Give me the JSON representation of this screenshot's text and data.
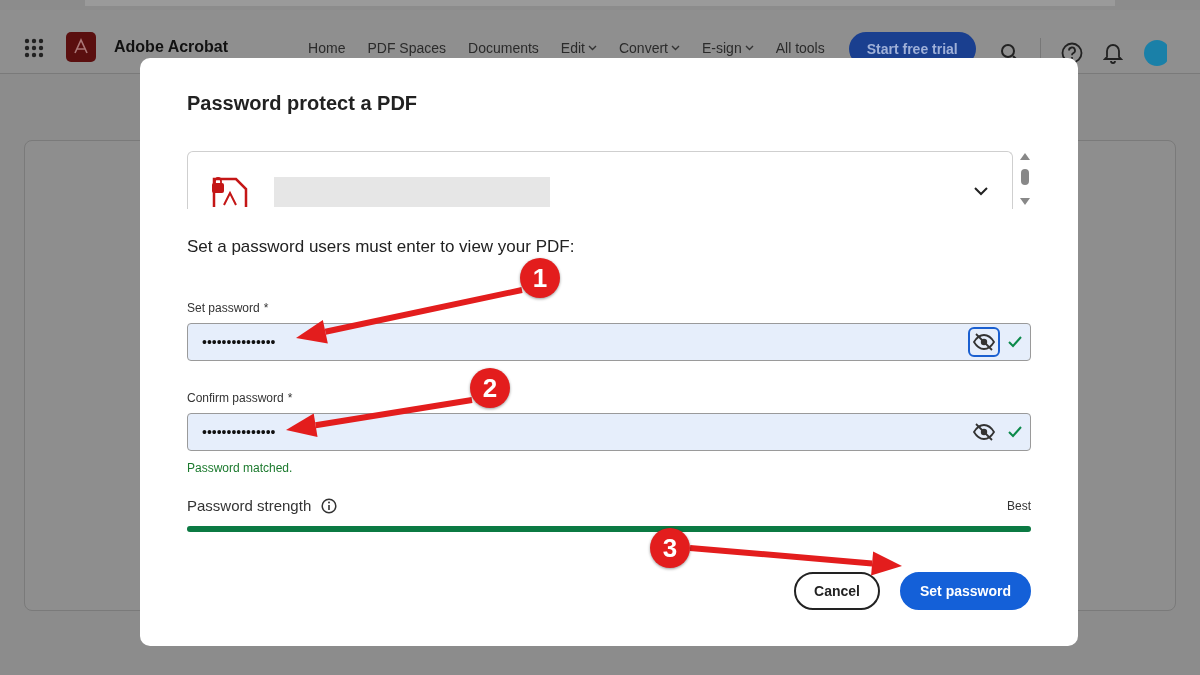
{
  "app_bar": {
    "product": "Adobe Acrobat",
    "nav": [
      {
        "label": "Home",
        "dropdown": false
      },
      {
        "label": "PDF Spaces",
        "dropdown": false
      },
      {
        "label": "Documents",
        "dropdown": false
      },
      {
        "label": "Edit",
        "dropdown": true
      },
      {
        "label": "Convert",
        "dropdown": true
      },
      {
        "label": "E-sign",
        "dropdown": true
      },
      {
        "label": "All tools",
        "dropdown": false
      }
    ],
    "cta": "Start free trial"
  },
  "dialog": {
    "title": "Password protect a PDF",
    "file": {
      "locked": true,
      "expanded": false
    },
    "instruction": "Set a password users must enter to view your PDF:",
    "fields": [
      {
        "label": "Set password",
        "required_mark": "*",
        "value": "•••••••••••••••",
        "reveal_focused": true,
        "valid": true
      },
      {
        "label": "Confirm password",
        "required_mark": "*",
        "value": "•••••••••••••••",
        "reveal_focused": false,
        "valid": true
      }
    ],
    "match_message": "Password matched.",
    "strength": {
      "label": "Password strength",
      "rating": "Best",
      "level": 1
    },
    "buttons": [
      {
        "label": "Cancel",
        "kind": "secondary"
      },
      {
        "label": "Set password",
        "kind": "primary"
      }
    ]
  },
  "annotations": [
    {
      "number": "1"
    },
    {
      "number": "2"
    },
    {
      "number": "3"
    }
  ]
}
